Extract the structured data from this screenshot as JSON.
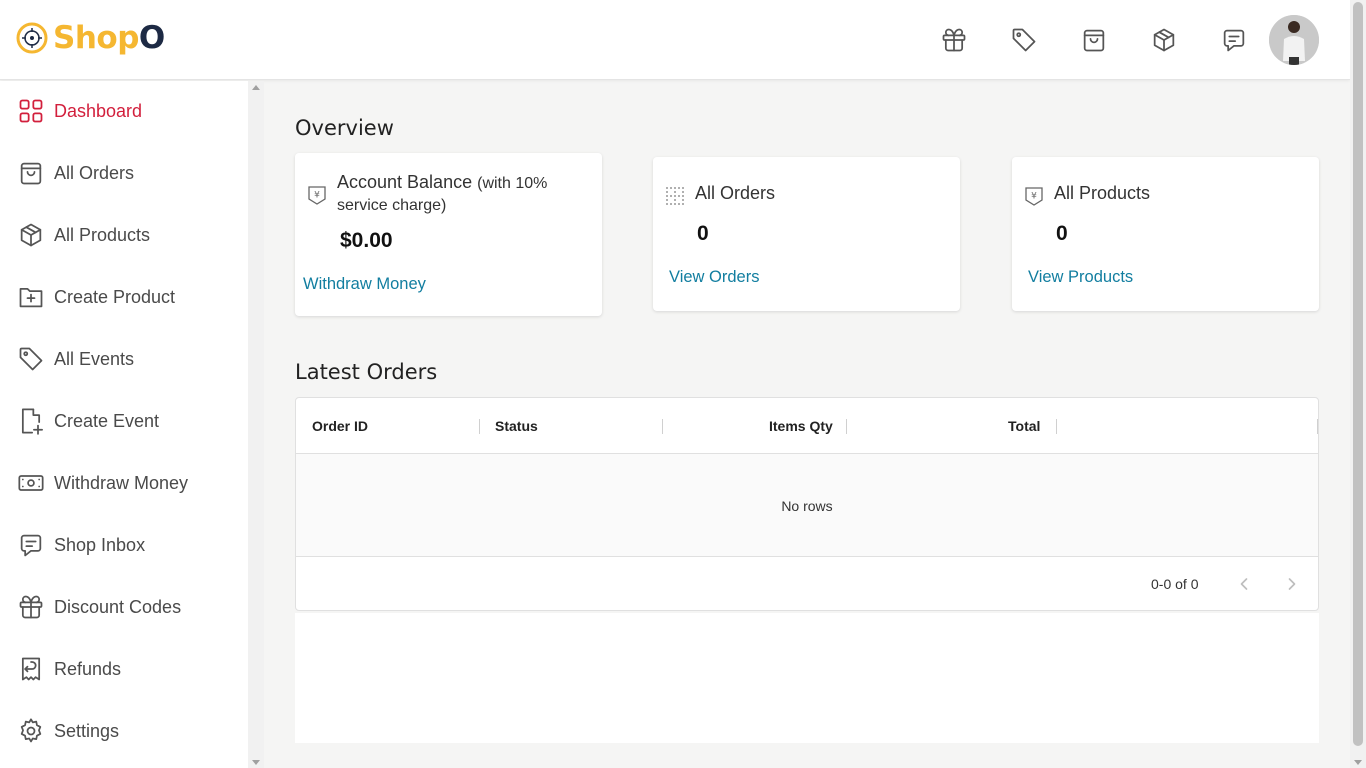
{
  "brand": {
    "shop": "Shop",
    "o": "O"
  },
  "header": {
    "icons": [
      "gift-icon",
      "tag-icon",
      "shopping-bag-icon",
      "package-icon",
      "message-icon"
    ]
  },
  "sidebar": {
    "items": [
      {
        "label": "Dashboard",
        "icon": "dashboard-icon",
        "active": true
      },
      {
        "label": "All Orders",
        "icon": "shopping-bag-icon"
      },
      {
        "label": "All Products",
        "icon": "package-icon"
      },
      {
        "label": "Create Product",
        "icon": "folder-plus-icon"
      },
      {
        "label": "All Events",
        "icon": "tag-icon"
      },
      {
        "label": "Create Event",
        "icon": "file-plus-icon"
      },
      {
        "label": "Withdraw Money",
        "icon": "cash-icon"
      },
      {
        "label": "Shop Inbox",
        "icon": "message-icon"
      },
      {
        "label": "Discount Codes",
        "icon": "gift-icon"
      },
      {
        "label": "Refunds",
        "icon": "refund-icon"
      },
      {
        "label": "Settings",
        "icon": "gear-icon"
      }
    ],
    "active_color": "#d21f3c"
  },
  "overview": {
    "title": "Overview",
    "balance": {
      "title": "Account Balance",
      "note": "(with 10% service charge)",
      "value": "$0.00",
      "link": "Withdraw Money"
    },
    "orders": {
      "title": "All Orders",
      "value": "0",
      "link": "View Orders"
    },
    "products": {
      "title": "All Products",
      "value": "0",
      "link": "View Products"
    }
  },
  "latest_orders": {
    "title": "Latest Orders",
    "columns": [
      "Order ID",
      "Status",
      "Items Qty",
      "Total"
    ],
    "empty_text": "No rows",
    "pagination": "0-0 of 0"
  },
  "colors": {
    "link": "#127ea0",
    "brand_yellow": "#f5b731",
    "brand_dark": "#1d2a44"
  }
}
